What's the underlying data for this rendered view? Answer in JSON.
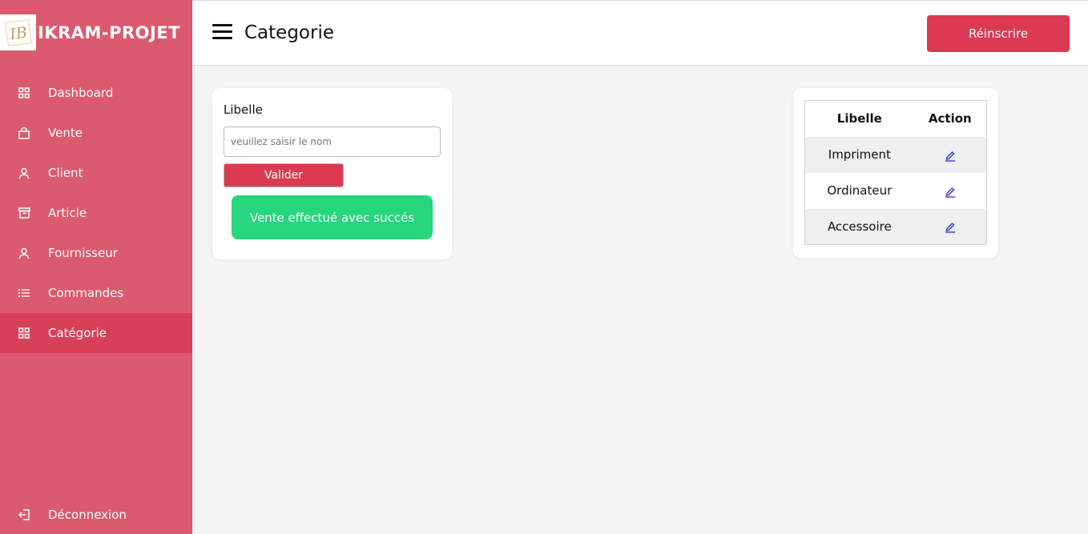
{
  "brand": {
    "name": "IKRAM-PROJET",
    "logo_text": "IB"
  },
  "sidebar": {
    "items": [
      {
        "label": "Dashboard",
        "icon": "grid-icon"
      },
      {
        "label": "Vente",
        "icon": "bag-icon"
      },
      {
        "label": "Client",
        "icon": "user-icon"
      },
      {
        "label": "Article",
        "icon": "archive-icon"
      },
      {
        "label": "Fournisseur",
        "icon": "user-icon"
      },
      {
        "label": "Commandes",
        "icon": "list-icon"
      },
      {
        "label": "Catégorie",
        "icon": "grid-icon",
        "active": true
      }
    ],
    "logout": {
      "label": "Déconnexion",
      "icon": "logout-icon"
    }
  },
  "header": {
    "title": "Categorie",
    "button_label": "Réinscrire"
  },
  "form": {
    "label": "Libelle",
    "input_placeholder": "veuillez saisir le nom",
    "input_value": "",
    "submit_label": "Valider",
    "success_message": "Vente effectué avec succés"
  },
  "table": {
    "columns": [
      "Libelle",
      "Action"
    ],
    "rows": [
      {
        "libelle": "Impriment"
      },
      {
        "libelle": "Ordinateur"
      },
      {
        "libelle": "Accessoire"
      }
    ]
  },
  "colors": {
    "sidebar_bg": "#dc5a6e",
    "sidebar_active": "#d8405a",
    "accent_button": "#dc3a52",
    "success": "#26d67c",
    "edit_icon": "#2a2ad6"
  }
}
